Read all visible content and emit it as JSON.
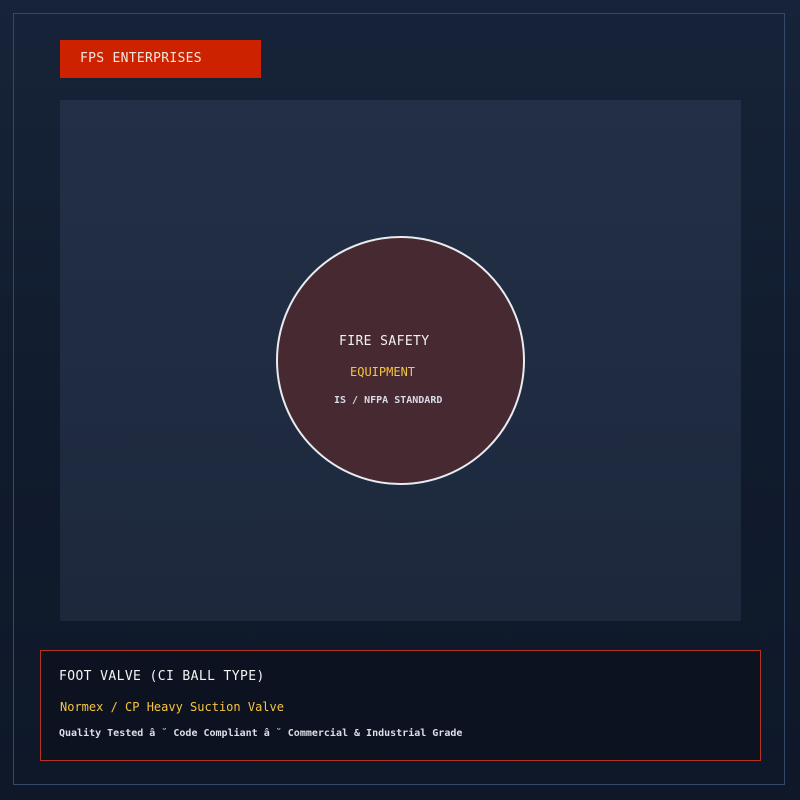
{
  "brand": {
    "name": "FPS ENTERPRISES"
  },
  "emblem": {
    "line1": "FIRE SAFETY",
    "line2": "EQUIPMENT",
    "line3": "IS / NFPA STANDARD"
  },
  "product": {
    "title": "FOOT VALVE (CI BALL TYPE)",
    "subtitle": "Normex / CP Heavy Suction Valve",
    "tagline": "Quality Tested â ˘ Code Compliant â ˘ Commercial & Industrial Grade"
  },
  "colors": {
    "brand_badge": "#cc2200",
    "accent_yellow": "#f5c542",
    "card_border": "#b33420",
    "emblem_fill": "#472931"
  }
}
